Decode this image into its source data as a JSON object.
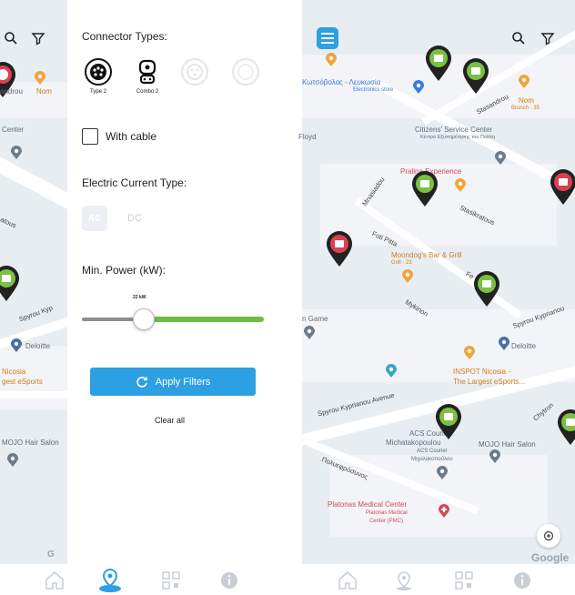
{
  "filters": {
    "connector_types_heading": "Connector Types:",
    "connectors": [
      {
        "label": "Type 2",
        "state": "selected"
      },
      {
        "label": "Combo 2",
        "state": "selected"
      },
      {
        "label": "",
        "state": "disabled"
      },
      {
        "label": "",
        "state": "disabled"
      }
    ],
    "with_cable_label": "With cable",
    "with_cable_checked": false,
    "electric_current_heading": "Electric Current Type:",
    "ac_label": "AC",
    "dc_label": "DC",
    "min_power_heading": "Min. Power (kW):",
    "min_power_value": "22 kW",
    "apply_button_label": "Apply Filters",
    "clear_all_label": "Clear all"
  },
  "left_map": {
    "labels": [
      "androu",
      "Nom",
      "Center",
      "atous",
      "Spyrou Kyp",
      "Deloitte",
      "Nicosia",
      "gest eSports",
      "MOJO Hair Salon"
    ]
  },
  "right_map": {
    "labels": {
      "store": "Κωτσόβολος - Λευκωσία",
      "store_sub": "Electronics store",
      "stasandrou": "Stasandrou",
      "nom": "Nom",
      "nom_sub": "Brunch · 35",
      "citizens": "Citizens' Service Center",
      "citizens_sub": "Κέντρο Εξυπηρέτησης του Πολίτη",
      "floyd": "Floyd",
      "pralina": "Pralina Experience",
      "mnasiadou": "Mnasiadou",
      "stasikratous": "Stasikratous",
      "foti_pitta": "Foti Pitta",
      "moondogs": "Moondog's Bar & Grill",
      "moondogs_sub": "Grill · 23",
      "fe": "Fe",
      "mykinon": "Mykinon",
      "game": "n Game",
      "spyrou_kyprianou": "Spyrou Kyprianou",
      "deloitte": "Deloitte",
      "inspot": "INSPOT Nicosia -",
      "inspot_sub": "The Largest eSports...",
      "spyrou_avenue": "Spyrou Kyprianou Avenue",
      "chytron": "Chytron",
      "acs": "ACS Courier",
      "acs_line2": "Michatakopoulou",
      "acs_sub": "ACS Courier",
      "acs_sub2": "Μιχαλακοπούλου",
      "mojo": "MOJO Hair Salon",
      "poluefrosi": "Πολυεφρόσυνος",
      "platonas": "Platonas Medical Center",
      "platonas_sub": "Platonas Medical",
      "platonas_sub2": "Center (PMC)",
      "google": "Google"
    }
  },
  "colors": {
    "accent_blue": "#2d9fe3",
    "slider_green": "#6cbe45",
    "pin_green": "#7bc043",
    "pin_red": "#d9414f",
    "poi_orange": "#f2a33a"
  },
  "nav": {
    "icons": [
      "home-icon",
      "charging-location-icon",
      "qr-code-icon",
      "info-icon"
    ]
  }
}
